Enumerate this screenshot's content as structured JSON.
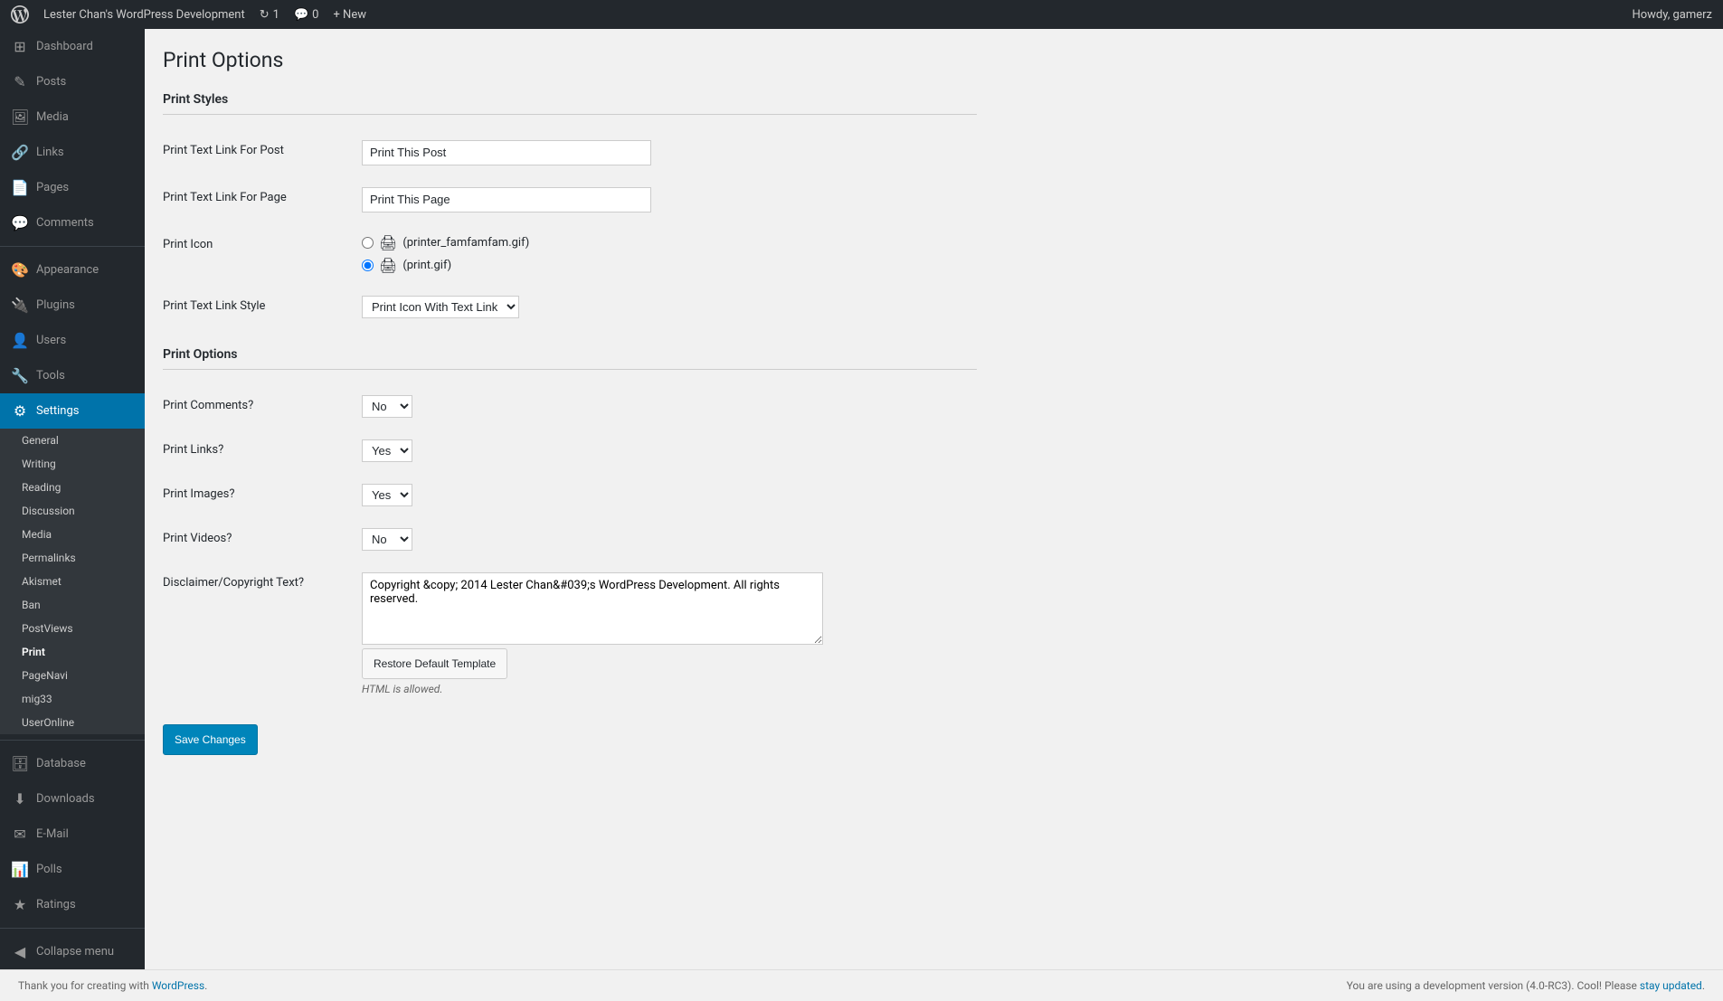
{
  "adminbar": {
    "site_name": "Lester Chan's WordPress Development",
    "updates_count": "1",
    "comments_count": "0",
    "new_label": "+ New",
    "howdy": "Howdy, gamerz"
  },
  "sidebar": {
    "menu_items": [
      {
        "label": "Dashboard",
        "icon": "⊞",
        "id": "dashboard"
      },
      {
        "label": "Posts",
        "icon": "✎",
        "id": "posts"
      },
      {
        "label": "Media",
        "icon": "🖼",
        "id": "media"
      },
      {
        "label": "Links",
        "icon": "🔗",
        "id": "links"
      },
      {
        "label": "Pages",
        "icon": "📄",
        "id": "pages"
      },
      {
        "label": "Comments",
        "icon": "💬",
        "id": "comments"
      }
    ],
    "appearance_label": "Appearance",
    "plugins_label": "Plugins",
    "users_label": "Users",
    "tools_label": "Tools",
    "settings_label": "Settings",
    "settings_submenu": [
      {
        "label": "General",
        "id": "general"
      },
      {
        "label": "Writing",
        "id": "writing"
      },
      {
        "label": "Reading",
        "id": "reading"
      },
      {
        "label": "Discussion",
        "id": "discussion"
      },
      {
        "label": "Media",
        "id": "media"
      },
      {
        "label": "Permalinks",
        "id": "permalinks"
      },
      {
        "label": "Akismet",
        "id": "akismet"
      },
      {
        "label": "Ban",
        "id": "ban"
      },
      {
        "label": "PostViews",
        "id": "postviews"
      },
      {
        "label": "Print",
        "id": "print"
      },
      {
        "label": "PageNavi",
        "id": "pagenavi"
      },
      {
        "label": "mig33",
        "id": "mig33"
      },
      {
        "label": "UserOnline",
        "id": "useronline"
      }
    ],
    "database_label": "Database",
    "downloads_label": "Downloads",
    "email_label": "E-Mail",
    "polls_label": "Polls",
    "ratings_label": "Ratings",
    "collapse_label": "Collapse menu"
  },
  "page": {
    "title": "Print Options",
    "print_styles_heading": "Print Styles",
    "print_options_heading": "Print Options",
    "fields": {
      "text_link_post_label": "Print Text Link For Post",
      "text_link_post_value": "Print This Post",
      "text_link_page_label": "Print Text Link For Page",
      "text_link_page_value": "Print This Page",
      "print_icon_label": "Print Icon",
      "print_icon_option1_text": "(printer_famfamfam.gif)",
      "print_icon_option2_text": "(print.gif)",
      "print_text_link_style_label": "Print Text Link Style",
      "print_text_link_style_value": "Print Icon With Text Link",
      "print_comments_label": "Print Comments?",
      "print_comments_value": "No",
      "print_links_label": "Print Links?",
      "print_links_value": "Yes",
      "print_images_label": "Print Images?",
      "print_images_value": "Yes",
      "print_videos_label": "Print Videos?",
      "print_videos_value": "No",
      "disclaimer_label": "Disclaimer/Copyright Text?",
      "disclaimer_value": "Copyright &copy; 2014 Lester Chan&#039;s WordPress Development. All rights reserved.",
      "html_allowed": "HTML is allowed."
    },
    "restore_button": "Restore Default Template",
    "save_button": "Save Changes"
  },
  "footer": {
    "left_text": "Thank you for creating with",
    "left_link": "WordPress",
    "right_text": "You are using a development version (4.0-RC3). Cool! Please",
    "right_link": "stay updated"
  }
}
